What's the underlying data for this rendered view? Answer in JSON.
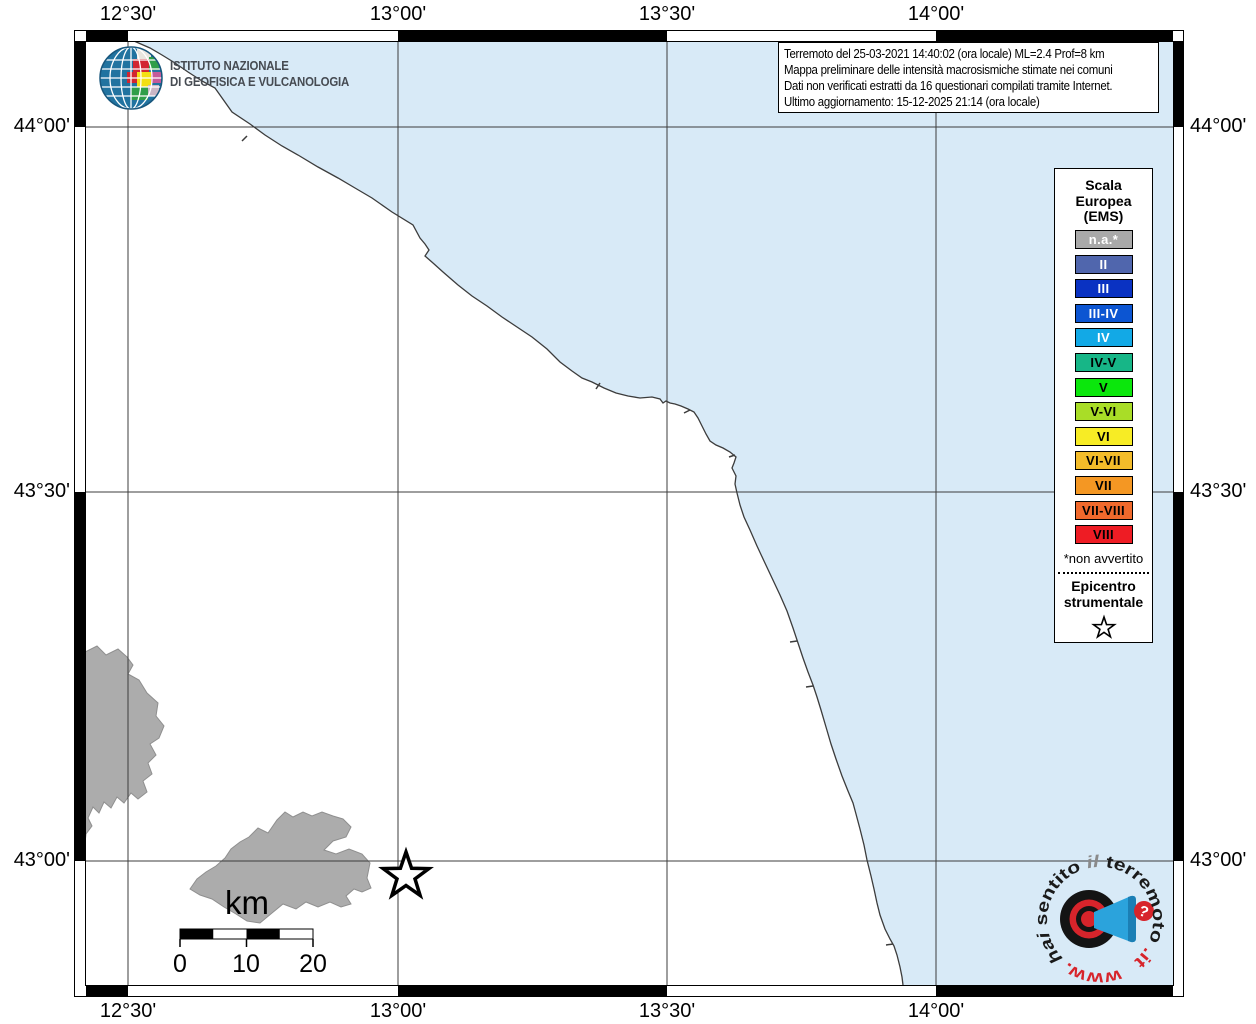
{
  "axes": {
    "top": [
      "12°30'",
      "13°00'",
      "13°30'",
      "14°00'"
    ],
    "bottom": [
      "12°30'",
      "13°00'",
      "13°30'",
      "14°00'"
    ],
    "left": [
      "44°00'",
      "43°30'",
      "43°00'"
    ],
    "right": [
      "44°00'",
      "43°30'",
      "43°00'"
    ]
  },
  "info_box": {
    "lines": [
      "Terremoto del 25-03-2021 14:40:02 (ora locale) ML=2.4 Prof=8 km",
      "Mappa preliminare delle intensità macrosismiche stimate nei comuni",
      "Dati non verificati estratti da 16 questionari compilati tramite Internet.",
      "Ultimo aggiornamento: 15-12-2025 21:14 (ora locale)"
    ]
  },
  "ingv_logo": {
    "line1": "ISTITUTO NAZIONALE",
    "line2": "DI GEOFISICA E VULCANOLOGIA"
  },
  "legend": {
    "title_lines": [
      "Scala",
      "Europea",
      "(EMS)"
    ],
    "items": [
      {
        "label": "n.a.*",
        "color": "#a9a9a9",
        "text": "#ffffff"
      },
      {
        "label": "II",
        "color": "#5066ad",
        "text": "#ffffff"
      },
      {
        "label": "III",
        "color": "#0a32c2",
        "text": "#ffffff"
      },
      {
        "label": "III-IV",
        "color": "#0c55d2",
        "text": "#ffffff"
      },
      {
        "label": "IV",
        "color": "#12a9e6",
        "text": "#ffffff"
      },
      {
        "label": "IV-V",
        "color": "#17b687",
        "text": "#000000"
      },
      {
        "label": "V",
        "color": "#0be70c",
        "text": "#000000"
      },
      {
        "label": "V-VI",
        "color": "#a9dd27",
        "text": "#000000"
      },
      {
        "label": "VI",
        "color": "#f7ec25",
        "text": "#000000"
      },
      {
        "label": "VI-VII",
        "color": "#f3bc2a",
        "text": "#000000"
      },
      {
        "label": "VII",
        "color": "#f49723",
        "text": "#000000"
      },
      {
        "label": "VII-VIII",
        "color": "#f0692c",
        "text": "#000000"
      },
      {
        "label": "VIII",
        "color": "#ee1c24",
        "text": "#000000"
      }
    ],
    "footnote": "*non avvertito",
    "epicenter_lines": [
      "Epicentro",
      "strumentale"
    ]
  },
  "scale_bar": {
    "unit": "km",
    "ticks": [
      "0",
      "10",
      "20"
    ]
  },
  "watermark": {
    "www": "www.",
    "hai": "hai",
    "sentito": "sentito",
    "il": "il",
    "terremoto": "terremoto",
    "it": ".it",
    "question_mark": "?"
  },
  "map": {
    "colors": {
      "sea": "#d8eaf7",
      "land": "#ffffff",
      "comune_not_felt": "#acacac",
      "coastline": "#3c3c3c",
      "grid": "#3c3c3c"
    }
  }
}
